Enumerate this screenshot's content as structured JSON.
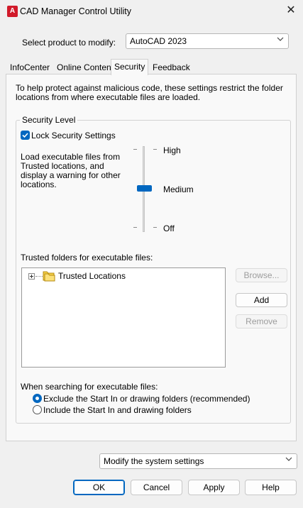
{
  "window": {
    "title": "CAD Manager Control Utility",
    "app_icon_letter": "A"
  },
  "product": {
    "label": "Select product to modify:",
    "value": "AutoCAD 2023"
  },
  "tabs": [
    {
      "label": "InfoCenter"
    },
    {
      "label": "Online Content"
    },
    {
      "label": "Security"
    },
    {
      "label": "Feedback"
    }
  ],
  "active_tab": "Security",
  "security": {
    "intro": "To help protect against malicious code, these settings restrict the folder locations from where executable files are loaded.",
    "group_label": "Security Level",
    "lock_label": "Lock Security Settings",
    "lock_checked": true,
    "description": "Load executable files from Trusted locations, and display a warning for other locations.",
    "levels": [
      "High",
      "Medium",
      "Off"
    ],
    "current_level": "Medium",
    "trusted_label": "Trusted folders for executable files:",
    "tree_item": "Trusted Locations",
    "buttons": {
      "browse": "Browse...",
      "add": "Add",
      "remove": "Remove"
    },
    "search_label": "When searching for executable files:",
    "options": [
      {
        "label": "Exclude the Start In or drawing folders (recommended)",
        "selected": true
      },
      {
        "label": "Include the Start In and drawing folders",
        "selected": false
      }
    ]
  },
  "footer": {
    "mode_value": "Modify the system settings",
    "ok": "OK",
    "cancel": "Cancel",
    "apply": "Apply",
    "help": "Help"
  },
  "colors": {
    "accent": "#0067c0",
    "app_icon": "#d11a2a"
  }
}
